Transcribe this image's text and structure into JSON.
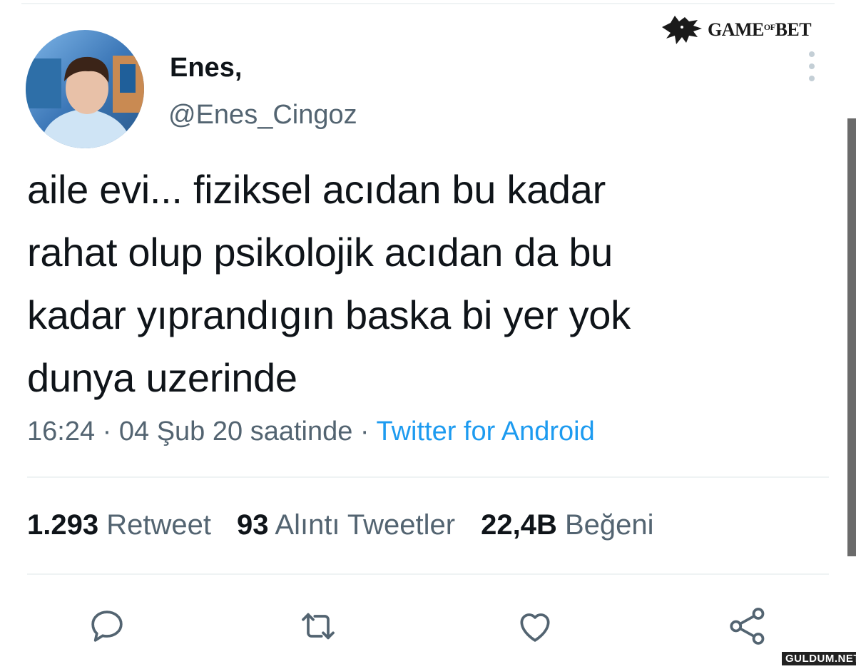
{
  "watermark": {
    "logo_text_left": "GAME",
    "logo_text_mid": "OF",
    "logo_text_right": "BET",
    "footer": "GULDUM.NET"
  },
  "author": {
    "name": "Enes,",
    "handle": "@Enes_Cingoz",
    "avatar": "profile-photo"
  },
  "tweet": {
    "lines": [
      "aile evi... fiziksel acıdan bu kadar",
      "rahat olup psikolojik acıdan da bu",
      "kadar yıprandıgın baska bi yer yok",
      "dunya uzerinde"
    ],
    "time": "16:24",
    "date_text": "04 Şub 20 saatinde",
    "separator": " · ",
    "source": "Twitter for Android"
  },
  "stats": {
    "retweets": {
      "value": "1.293",
      "label": "Retweet"
    },
    "quotes": {
      "value": "93",
      "label": "Alıntı Tweetler"
    },
    "likes": {
      "value": "22,4B",
      "label": "Beğeni"
    }
  },
  "actions": [
    "reply-icon",
    "retweet-icon",
    "like-icon",
    "share-icon"
  ],
  "colors": {
    "accent": "#1d9bf0",
    "secondary_text": "#536471",
    "icon": "#536471"
  }
}
